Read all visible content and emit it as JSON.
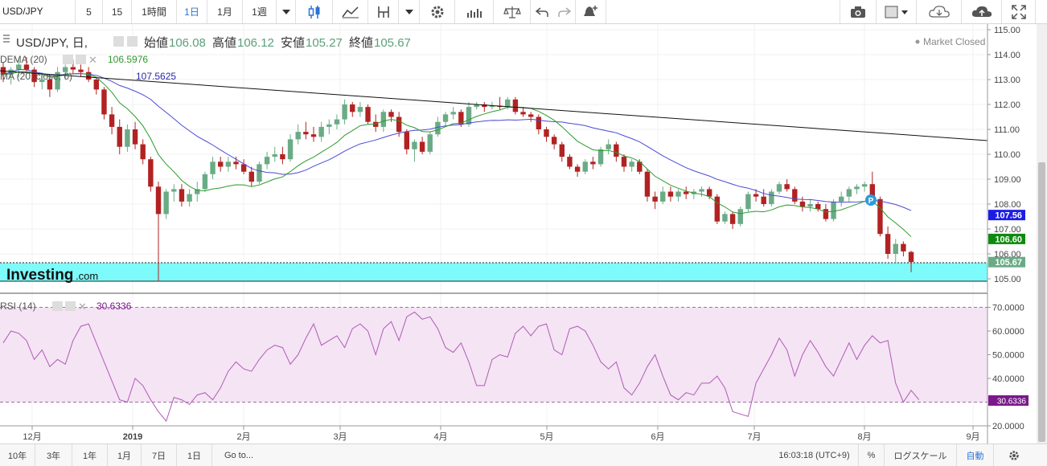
{
  "toolbar": {
    "symbol": "USD/JPY",
    "timeframes": [
      "5",
      "15",
      "1時間",
      "1日",
      "1月",
      "1週"
    ],
    "active_timeframe": "1日"
  },
  "legend": {
    "title": "USD/JPY, 日,",
    "open_label": "始値",
    "open_value": "106.08",
    "high_label": "高値",
    "high_value": "106.12",
    "low_label": "安値",
    "low_value": "105.27",
    "close_label": "終値",
    "close_value": "105.67",
    "market_status": "Market Closed",
    "dema_label": "DEMA (20)",
    "dema_value": "106.5976",
    "ma_label": "MA (20, close, 0)",
    "ma_value": "107.5625",
    "rsi_label": "RSI (14)",
    "rsi_value": "30.6336"
  },
  "price_axis": {
    "ticks": [
      "115.00",
      "114.00",
      "113.00",
      "112.00",
      "111.00",
      "110.00",
      "109.00",
      "108.00",
      "107.00",
      "106.00",
      "105.00"
    ],
    "badges": [
      {
        "value": "107.56",
        "color": "#1c1ce6"
      },
      {
        "value": "106.60",
        "color": "#0f8a0f"
      },
      {
        "value": "105.67",
        "color": "#6aab86"
      }
    ]
  },
  "rsi_axis": {
    "ticks": [
      "70.0000",
      "60.0000",
      "50.0000",
      "40.0000",
      "20.0000"
    ],
    "badge": "30.6336"
  },
  "time_axis": [
    "12月",
    "2019",
    "2月",
    "3月",
    "4月",
    "5月",
    "6月",
    "7月",
    "8月",
    "9月"
  ],
  "watermark": {
    "brand": "Investing",
    "suffix": ".com"
  },
  "marker_label": "P",
  "colors": {
    "up": "#6aab86",
    "down": "#b22222",
    "dema": "#2e9a2e",
    "ma": "#4a4ad6",
    "rsi": "#b05ab5",
    "rsi_band": "#f4e4f4",
    "highlight": "#7dfafa"
  },
  "chart_data": [
    {
      "type": "candlestick",
      "title": "USD/JPY, 日,",
      "ylim": [
        105.0,
        115.0
      ],
      "x_ticks": [
        "12月",
        "2019",
        "2月",
        "3月",
        "4月",
        "5月",
        "6月",
        "7月",
        "8月",
        "9月"
      ],
      "ohlc_columns": [
        "open",
        "high",
        "low",
        "close"
      ],
      "ohlc": [
        [
          113.5,
          113.7,
          112.9,
          113.2
        ],
        [
          113.2,
          113.5,
          112.8,
          113.4
        ],
        [
          113.4,
          113.8,
          113.1,
          113.6
        ],
        [
          113.6,
          113.9,
          113.3,
          113.4
        ],
        [
          113.4,
          113.5,
          112.7,
          112.9
        ],
        [
          112.9,
          113.2,
          112.6,
          113.0
        ],
        [
          113.0,
          113.2,
          112.3,
          112.6
        ],
        [
          112.6,
          113.5,
          112.5,
          113.3
        ],
        [
          113.3,
          113.6,
          113.0,
          113.5
        ],
        [
          113.5,
          113.8,
          113.2,
          113.4
        ],
        [
          113.4,
          113.6,
          113.1,
          113.3
        ],
        [
          113.3,
          113.5,
          112.9,
          113.0
        ],
        [
          113.0,
          113.1,
          112.4,
          112.6
        ],
        [
          112.6,
          112.7,
          111.4,
          111.6
        ],
        [
          111.6,
          111.9,
          110.8,
          111.1
        ],
        [
          111.1,
          111.4,
          110.0,
          110.3
        ],
        [
          110.3,
          111.2,
          110.1,
          111.0
        ],
        [
          111.0,
          111.3,
          110.2,
          110.4
        ],
        [
          110.4,
          110.6,
          109.6,
          109.8
        ],
        [
          109.8,
          109.9,
          108.5,
          108.7
        ],
        [
          108.7,
          108.9,
          104.9,
          107.6
        ],
        [
          107.6,
          108.6,
          107.4,
          108.5
        ],
        [
          108.5,
          108.8,
          108.1,
          108.6
        ],
        [
          108.6,
          108.8,
          107.9,
          108.1
        ],
        [
          108.1,
          108.6,
          107.9,
          108.4
        ],
        [
          108.4,
          108.9,
          108.1,
          108.6
        ],
        [
          108.6,
          109.3,
          108.5,
          109.2
        ],
        [
          109.2,
          109.9,
          109.0,
          109.7
        ],
        [
          109.7,
          109.9,
          109.3,
          109.5
        ],
        [
          109.5,
          109.9,
          109.3,
          109.7
        ],
        [
          109.7,
          109.9,
          109.4,
          109.6
        ],
        [
          109.6,
          109.8,
          109.2,
          109.3
        ],
        [
          109.3,
          109.5,
          108.7,
          108.9
        ],
        [
          108.9,
          109.7,
          108.8,
          109.6
        ],
        [
          109.6,
          110.1,
          109.4,
          109.9
        ],
        [
          109.9,
          110.3,
          109.7,
          110.0
        ],
        [
          110.0,
          110.3,
          109.6,
          109.8
        ],
        [
          109.8,
          110.8,
          109.7,
          110.6
        ],
        [
          110.6,
          111.2,
          110.4,
          110.9
        ],
        [
          110.9,
          111.3,
          110.6,
          110.8
        ],
        [
          110.8,
          111.1,
          110.5,
          110.7
        ],
        [
          110.7,
          111.3,
          110.5,
          111.1
        ],
        [
          111.1,
          111.4,
          110.8,
          111.2
        ],
        [
          111.2,
          111.6,
          111.0,
          111.4
        ],
        [
          111.4,
          112.2,
          111.2,
          112.0
        ],
        [
          112.0,
          112.1,
          111.5,
          111.7
        ],
        [
          111.7,
          112.1,
          111.5,
          111.9
        ],
        [
          111.9,
          112.0,
          111.2,
          111.3
        ],
        [
          111.3,
          111.6,
          110.9,
          111.1
        ],
        [
          111.1,
          111.8,
          110.9,
          111.7
        ],
        [
          111.7,
          111.8,
          111.3,
          111.5
        ],
        [
          111.5,
          111.7,
          110.7,
          110.9
        ],
        [
          110.9,
          111.0,
          110.0,
          110.2
        ],
        [
          110.2,
          110.6,
          109.7,
          110.5
        ],
        [
          110.5,
          110.7,
          110.0,
          110.1
        ],
        [
          110.1,
          110.9,
          110.0,
          110.8
        ],
        [
          110.8,
          111.5,
          110.7,
          111.3
        ],
        [
          111.3,
          111.7,
          111.1,
          111.6
        ],
        [
          111.6,
          111.9,
          111.4,
          111.7
        ],
        [
          111.7,
          111.8,
          111.1,
          111.2
        ],
        [
          111.2,
          112.1,
          111.1,
          111.9
        ],
        [
          111.9,
          112.1,
          111.8,
          112.0
        ],
        [
          112.0,
          112.1,
          111.7,
          111.9
        ],
        [
          111.9,
          112.1,
          111.8,
          111.95
        ],
        [
          111.95,
          112.3,
          111.8,
          111.9
        ],
        [
          111.9,
          112.3,
          111.8,
          112.2
        ],
        [
          112.2,
          112.3,
          111.6,
          111.7
        ],
        [
          111.7,
          111.9,
          111.5,
          111.6
        ],
        [
          111.6,
          111.7,
          111.3,
          111.5
        ],
        [
          111.5,
          111.6,
          110.8,
          111.0
        ],
        [
          111.0,
          111.1,
          110.5,
          110.7
        ],
        [
          110.7,
          110.8,
          110.2,
          110.4
        ],
        [
          110.4,
          110.5,
          109.7,
          109.9
        ],
        [
          109.9,
          110.0,
          109.4,
          109.5
        ],
        [
          109.5,
          109.6,
          109.1,
          109.3
        ],
        [
          109.3,
          109.8,
          109.2,
          109.7
        ],
        [
          109.7,
          109.9,
          109.4,
          109.6
        ],
        [
          109.6,
          110.3,
          109.5,
          110.2
        ],
        [
          110.2,
          110.6,
          110.0,
          110.4
        ],
        [
          110.4,
          110.5,
          109.7,
          109.9
        ],
        [
          109.9,
          110.0,
          109.3,
          109.5
        ],
        [
          109.5,
          109.8,
          109.3,
          109.7
        ],
        [
          109.7,
          109.8,
          109.2,
          109.3
        ],
        [
          109.3,
          109.4,
          108.1,
          108.3
        ],
        [
          108.3,
          108.5,
          107.8,
          108.1
        ],
        [
          108.1,
          108.7,
          108.0,
          108.5
        ],
        [
          108.5,
          108.7,
          108.1,
          108.3
        ],
        [
          108.3,
          108.6,
          108.1,
          108.5
        ],
        [
          108.5,
          108.7,
          108.2,
          108.4
        ],
        [
          108.4,
          108.6,
          108.2,
          108.5
        ],
        [
          108.5,
          108.7,
          108.3,
          108.6
        ],
        [
          108.6,
          108.7,
          108.2,
          108.3
        ],
        [
          108.3,
          108.4,
          107.2,
          107.3
        ],
        [
          107.3,
          107.7,
          107.2,
          107.6
        ],
        [
          107.6,
          107.7,
          107.0,
          107.2
        ],
        [
          107.2,
          107.9,
          107.1,
          107.8
        ],
        [
          107.8,
          108.5,
          107.7,
          108.4
        ],
        [
          108.4,
          108.6,
          108.1,
          108.3
        ],
        [
          108.3,
          108.6,
          107.9,
          108.0
        ],
        [
          108.0,
          108.6,
          107.9,
          108.5
        ],
        [
          108.5,
          108.9,
          108.4,
          108.8
        ],
        [
          108.8,
          109.0,
          108.5,
          108.6
        ],
        [
          108.6,
          108.7,
          108.0,
          108.1
        ],
        [
          108.1,
          108.3,
          107.7,
          107.9
        ],
        [
          107.9,
          108.2,
          107.7,
          108.0
        ],
        [
          108.0,
          108.1,
          107.7,
          107.8
        ],
        [
          107.8,
          108.0,
          107.3,
          107.4
        ],
        [
          107.4,
          108.2,
          107.3,
          108.1
        ],
        [
          108.1,
          108.5,
          107.9,
          108.3
        ],
        [
          108.3,
          108.7,
          108.1,
          108.6
        ],
        [
          108.6,
          108.8,
          108.4,
          108.7
        ],
        [
          108.7,
          108.9,
          108.5,
          108.8
        ],
        [
          108.8,
          109.3,
          108.0,
          108.2
        ],
        [
          108.2,
          108.3,
          106.7,
          106.8
        ],
        [
          106.8,
          107.1,
          105.8,
          106.0
        ],
        [
          106.0,
          106.6,
          105.6,
          106.4
        ],
        [
          106.4,
          106.5,
          105.9,
          106.1
        ],
        [
          106.08,
          106.12,
          105.27,
          105.67
        ]
      ],
      "trendline": {
        "from": [
          113.35,
          "2018-11"
        ],
        "to": [
          110.55,
          "2019-09"
        ]
      }
    },
    {
      "type": "line",
      "title": "RSI (14)",
      "ylim": [
        20,
        70
      ],
      "levels": [
        70,
        30
      ],
      "last_value": 30.6336,
      "rsi_values": [
        55,
        60,
        59,
        56,
        48,
        52,
        45,
        48,
        46,
        56,
        62,
        63,
        55,
        47,
        39,
        31,
        30,
        40,
        37,
        31,
        26,
        22,
        32,
        31,
        29,
        33,
        34,
        31,
        36,
        43,
        47,
        44,
        43,
        48,
        52,
        54,
        53,
        46,
        50,
        57,
        63,
        54,
        56,
        58,
        53,
        61,
        63,
        60,
        50,
        61,
        64,
        56,
        66,
        68,
        65,
        66,
        61,
        53,
        51,
        55,
        47,
        37,
        37,
        48,
        50,
        49,
        59,
        62,
        58,
        62,
        63,
        52,
        50,
        61,
        62,
        60,
        54,
        47,
        44,
        47,
        36,
        33,
        38,
        45,
        50,
        41,
        33,
        31,
        34,
        33,
        38,
        38,
        41,
        36,
        26,
        25,
        24,
        38,
        44,
        50,
        57,
        52,
        41,
        50,
        56,
        51,
        45,
        41,
        48,
        55,
        48,
        54,
        58,
        55,
        56,
        38,
        30,
        35,
        31
      ]
    }
  ],
  "bottombar": {
    "ranges": [
      "10年",
      "3年",
      "1年",
      "1月",
      "7日",
      "1日"
    ],
    "goto": "Go to...",
    "time": "16:03:18 (UTC+9)",
    "percent": "%",
    "log": "ログスケール",
    "auto": "自動"
  }
}
